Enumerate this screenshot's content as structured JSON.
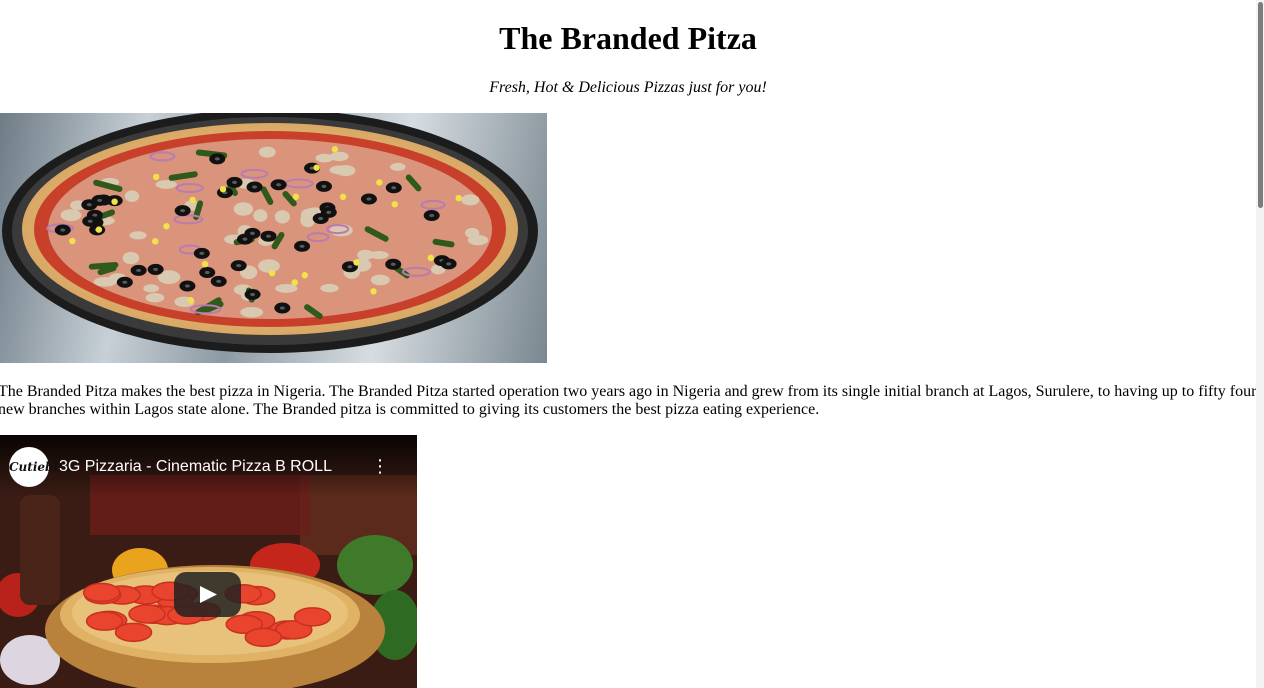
{
  "header": {
    "title": "The Branded Pitza",
    "tagline": "Fresh, Hot & Delicious Pizzas just for you!"
  },
  "hero_image": {
    "subject": "pizza-photo"
  },
  "description": "The Branded Pitza makes the best pizza in Nigeria. The Branded Pitza started operation two years ago in Nigeria and grew from its single initial branch at Lagos, Surulere, to having up to fifty four new branches within Lagos state alone. The Branded pitza is committed to giving its customers the best pizza eating experience.",
  "video": {
    "title": "3G Pizzaria - Cinematic Pizza B ROLL",
    "channel_logo": "Cutiebits",
    "menu_icon": "more-vert-icon",
    "play_icon": "play-icon"
  },
  "colors": {
    "youtube_play_bg": "#212121",
    "text": "#000000",
    "background": "#ffffff"
  }
}
